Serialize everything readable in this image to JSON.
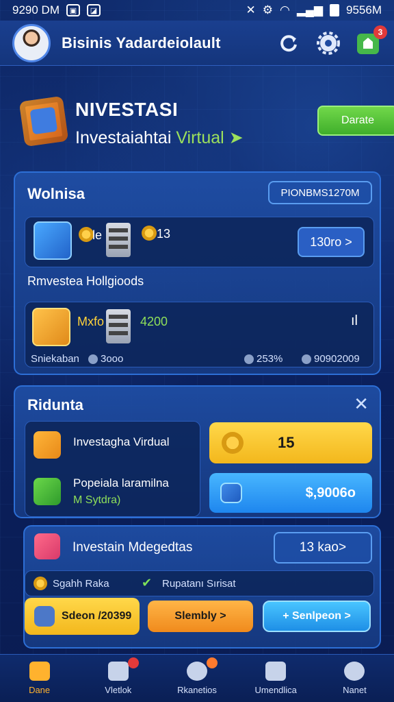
{
  "status_bar": {
    "time_left": "9290 DM",
    "time_right": "9556M"
  },
  "header": {
    "title": "Bisinis Yadardeiolault"
  },
  "hero": {
    "title": "NIVESTASI",
    "subtitle_main": "Investaiahtai",
    "subtitle_highlight": "Virtual",
    "button_label": "Darate"
  },
  "card1": {
    "title": "Wolnisa",
    "pill": "PIONBMS1270M",
    "row1": {
      "coin_label": "le",
      "num": "13",
      "button": "130ro >"
    },
    "section_label": "Rmvestea Hollgioods",
    "row2": {
      "name": "Mxfo",
      "value": "4200",
      "right": "ıl",
      "footer_label": "Sniekaban",
      "footer_a": "3ooo",
      "footer_b": "253%",
      "footer_c": "90902009"
    }
  },
  "card2": {
    "title": "Ridunta",
    "item1": "Investagha Virdual",
    "item2_title": "Popeiala laramilna",
    "item2_sub": "M Sytdra)",
    "yellow_value": "15",
    "blue_value": "$,9006o"
  },
  "card3": {
    "title": "Investain Mdegedtas",
    "pill": "13 kao>",
    "tag1": "Sgahh Raka",
    "tag2": "Rupatanı Sırisat",
    "btn1": "Sdeon /20399",
    "btn2": "Slembly >",
    "btn3": "+ Senlpeon >"
  },
  "nav": {
    "items": [
      {
        "label": "Dane"
      },
      {
        "label": "Vletlok"
      },
      {
        "label": "Rkanetios"
      },
      {
        "label": "Umendlica"
      },
      {
        "label": "Nanet"
      }
    ]
  },
  "colors": {
    "accent_green": "#3fae2b",
    "accent_yellow": "#f3b71c",
    "accent_blue": "#1e86ee",
    "badge_red": "#e23a3a"
  }
}
